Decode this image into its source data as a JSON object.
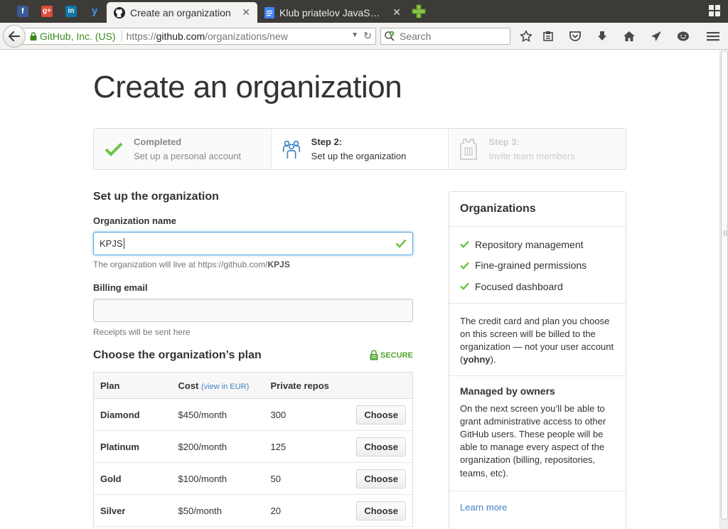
{
  "browser": {
    "pinned_tabs": [
      {
        "name": "facebook",
        "glyph": "f",
        "color": "#3b5998"
      },
      {
        "name": "google-plus",
        "glyph": "g+",
        "color": "#dd4b39"
      },
      {
        "name": "linkedin",
        "glyph": "in",
        "color": "#0e76a8"
      },
      {
        "name": "yammer",
        "glyph": "y",
        "color": "#0072c6"
      }
    ],
    "tabs": [
      {
        "title": "Create an organization",
        "active": true
      },
      {
        "title": "Klub priatelov JavaS…",
        "active": false
      }
    ],
    "identity": "GitHub, Inc. (US)",
    "url_prefix": "https://",
    "url_domain": "github.com",
    "url_path": "/organizations/new",
    "search_placeholder": "Search"
  },
  "page": {
    "title": "Create an organization",
    "steps": [
      {
        "title": "Completed",
        "subtitle": "Set up a personal account",
        "state": "done"
      },
      {
        "title": "Step 2:",
        "subtitle": "Set up the organization",
        "state": "current"
      },
      {
        "title": "Step 3:",
        "subtitle": "Invite team members",
        "state": "upcoming"
      }
    ],
    "form": {
      "heading": "Set up the organization",
      "org_name_label": "Organization name",
      "org_name_value": "KPJS",
      "org_url_note": "The organization will live at https://github.com/",
      "org_url_slug": "KPJS",
      "billing_label": "Billing email",
      "billing_value": "",
      "billing_note": "Receipts will be sent here"
    },
    "plans": {
      "heading": "Choose the organization’s plan",
      "secure_label": "SECURE",
      "columns": {
        "plan": "Plan",
        "cost": "Cost",
        "cost_link": "(view in EUR)",
        "repos": "Private repos"
      },
      "choose_label": "Choose",
      "rows": [
        {
          "plan": "Diamond",
          "cost": "$450/month",
          "repos": "300"
        },
        {
          "plan": "Platinum",
          "cost": "$200/month",
          "repos": "125"
        },
        {
          "plan": "Gold",
          "cost": "$100/month",
          "repos": "50"
        },
        {
          "plan": "Silver",
          "cost": "$50/month",
          "repos": "20"
        }
      ]
    },
    "sidebar": {
      "heading": "Organizations",
      "features": [
        "Repository management",
        "Fine-grained permissions",
        "Focused dashboard"
      ],
      "billing_text": "The credit card and plan you choose on this screen will be billed to the organization — not your user account (",
      "billing_user": "yohny",
      "billing_end": ").",
      "owners_heading": "Managed by owners",
      "owners_text": "On the next screen you’ll be able to grant administrative access to other GitHub users. These people will be able to manage every aspect of the organization (billing, repositories, teams, etc).",
      "learn_more": "Learn more"
    }
  },
  "colors": {
    "accent": "#4183c4",
    "success": "#55a532",
    "focus": "#51a7e8"
  }
}
